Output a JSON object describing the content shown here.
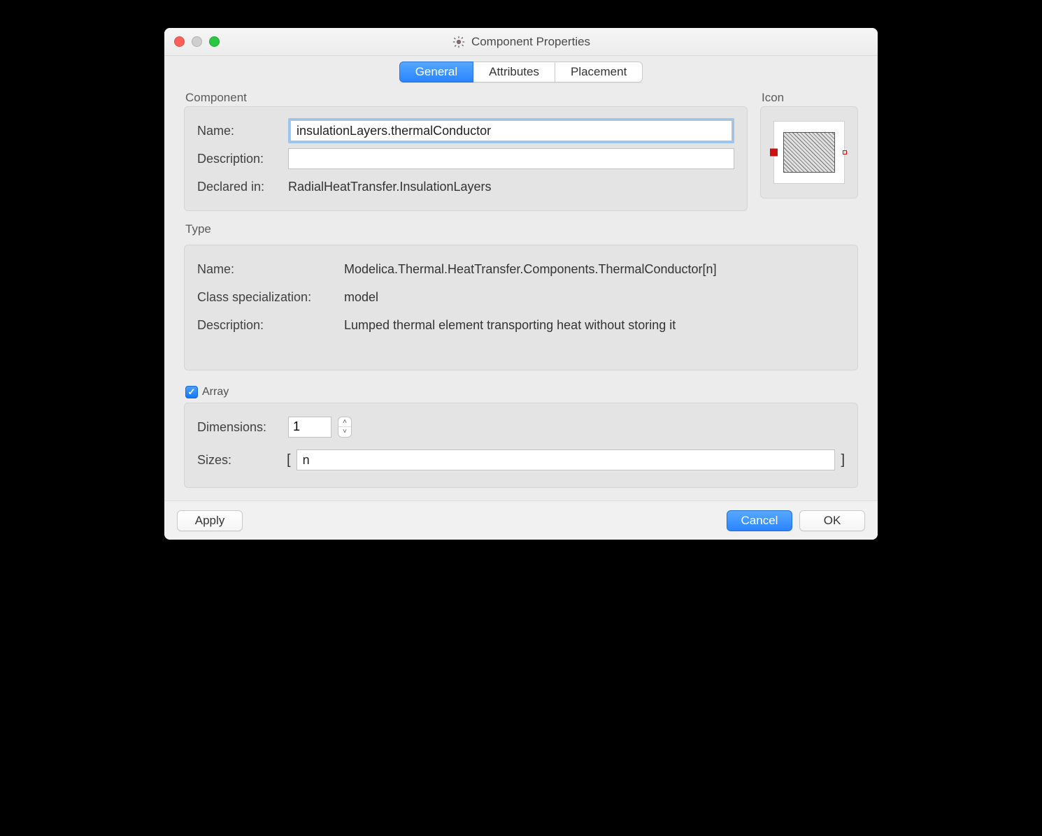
{
  "window": {
    "title": "Component Properties"
  },
  "tabs": {
    "general": "General",
    "attributes": "Attributes",
    "placement": "Placement"
  },
  "component": {
    "section_label": "Component",
    "name_label": "Name:",
    "name_value": "insulationLayers.thermalConductor",
    "description_label": "Description:",
    "description_value": "",
    "declared_in_label": "Declared in:",
    "declared_in_value": "RadialHeatTransfer.InsulationLayers"
  },
  "icon": {
    "section_label": "Icon"
  },
  "type": {
    "section_label": "Type",
    "name_label": "Name:",
    "name_value": "Modelica.Thermal.HeatTransfer.Components.ThermalConductor[n]",
    "specialization_label": "Class specialization:",
    "specialization_value": "model",
    "description_label": "Description:",
    "description_value": "Lumped thermal element transporting heat without storing it"
  },
  "array": {
    "checkbox_label": "Array",
    "checked": true,
    "dimensions_label": "Dimensions:",
    "dimensions_value": "1",
    "sizes_label": "Sizes:",
    "sizes_value": "n",
    "bracket_open": "[",
    "bracket_close": "]"
  },
  "footer": {
    "apply": "Apply",
    "cancel": "Cancel",
    "ok": "OK"
  }
}
